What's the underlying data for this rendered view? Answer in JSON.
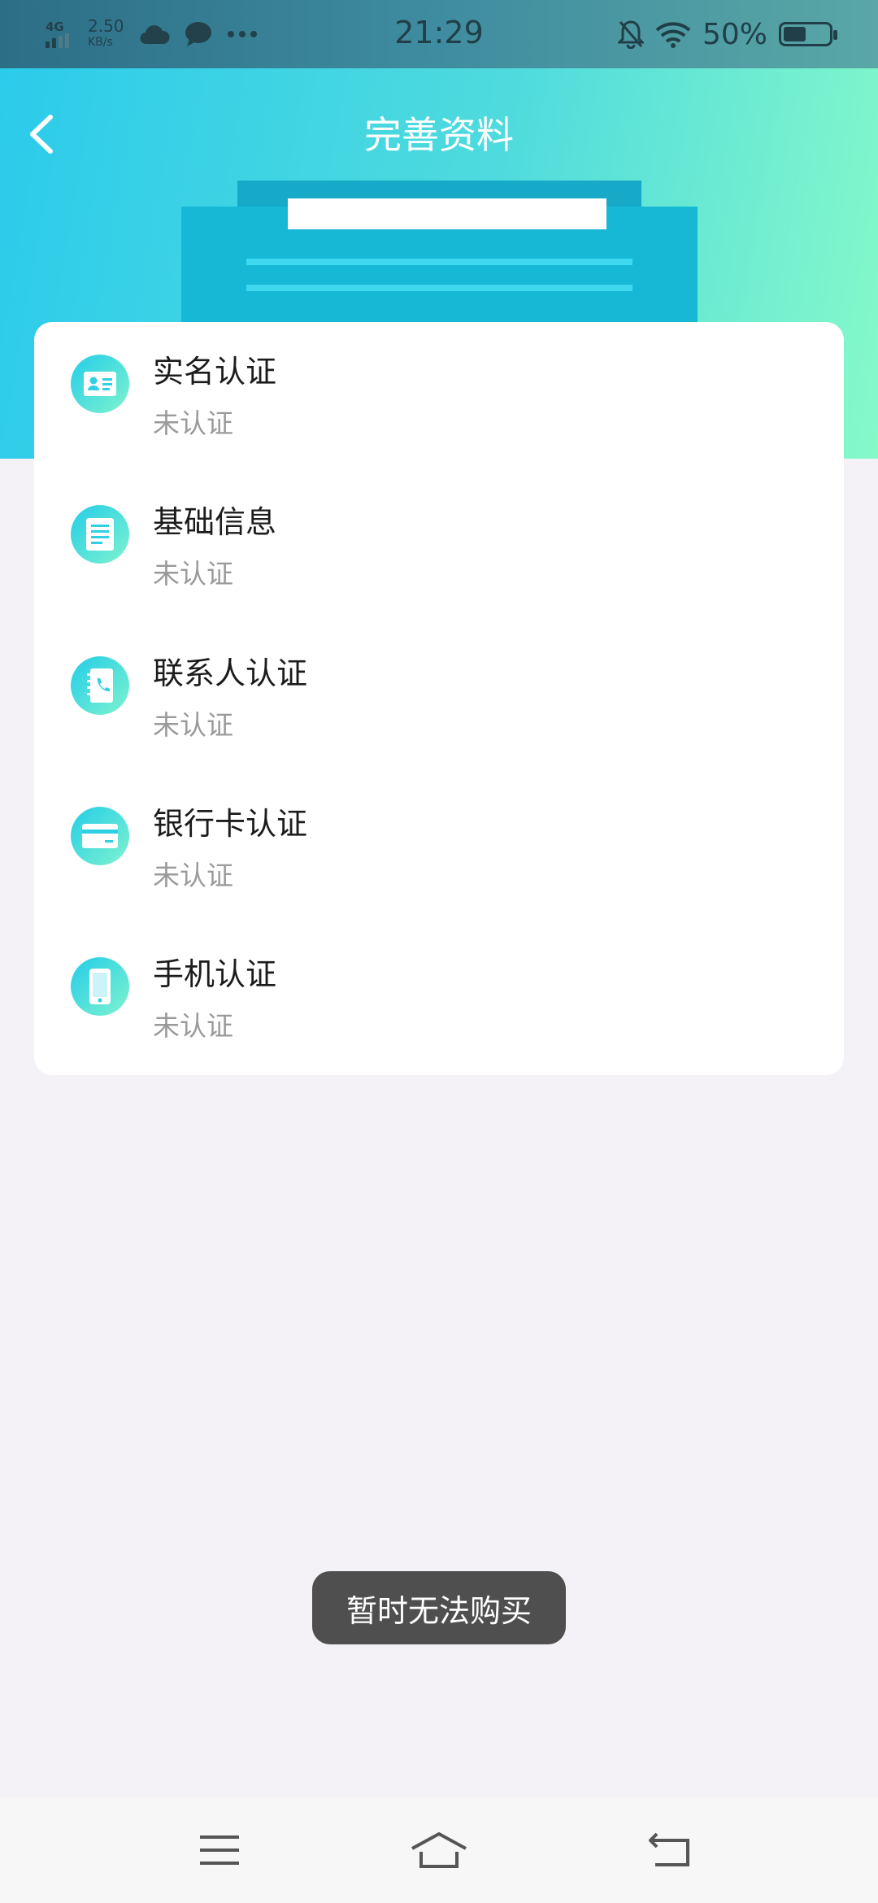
{
  "status_bar": {
    "network": "4G",
    "speed_value": "2.50",
    "speed_unit": "KB/s",
    "time": "21:29",
    "battery_percent": "50%",
    "battery_level": 0.5,
    "icons": [
      "signal-icon",
      "cloud-icon",
      "chat-bubble-icon",
      "more-icon",
      "mute-bell-icon",
      "wifi-icon",
      "battery-icon"
    ]
  },
  "header": {
    "title": "完善资料",
    "back_icon": "chevron-left-icon"
  },
  "items": [
    {
      "name": "实名认证",
      "status": "未认证",
      "icon": "id-card-icon"
    },
    {
      "name": "基础信息",
      "status": "未认证",
      "icon": "document-icon"
    },
    {
      "name": "联系人认证",
      "status": "未认证",
      "icon": "contact-book-icon"
    },
    {
      "name": "银行卡认证",
      "status": "未认证",
      "icon": "bank-card-icon"
    },
    {
      "name": "手机认证",
      "status": "未认证",
      "icon": "phone-icon"
    }
  ],
  "toast": "暂时无法购买",
  "nav_bar": {
    "icons": [
      "menu-icon",
      "home-icon",
      "back-icon"
    ]
  },
  "colors": {
    "header_start": "#2ccbeb",
    "header_end": "#86f9c9",
    "icon_start": "#23cde8",
    "icon_end": "#7ff3cf",
    "background": "#f4f2f7",
    "status_text": "#9a9a9a"
  }
}
